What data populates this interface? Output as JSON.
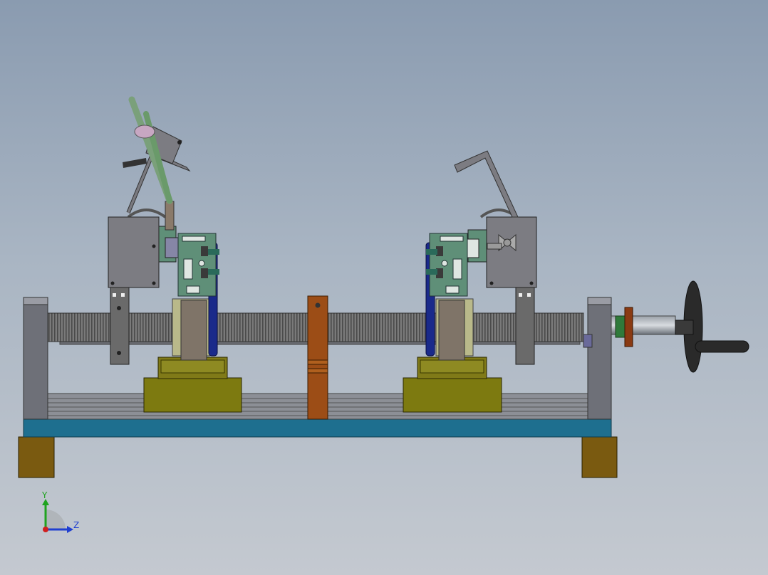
{
  "viewport": {
    "axis_triad": {
      "y_label": "Y",
      "z_label": "Z",
      "y_color": "#1fa31f",
      "z_color": "#1f3fd0",
      "origin_color": "#d01f1f"
    }
  },
  "colors": {
    "background_top": "#8a9bb0",
    "background_bottom": "#c4c9d0",
    "base_plate": "#1e6f8f",
    "feet": "#7a5a10",
    "carriage": "#7d7a10",
    "center_post": "#9c4d16",
    "lead_screw": "#6f6f6f",
    "clamp_housing": "#7c7c82",
    "bracket": "#5f8f78",
    "belt": "#1a2a8a",
    "welding_torch": "#7aa07a",
    "handwheel": "#2a2a2a"
  }
}
